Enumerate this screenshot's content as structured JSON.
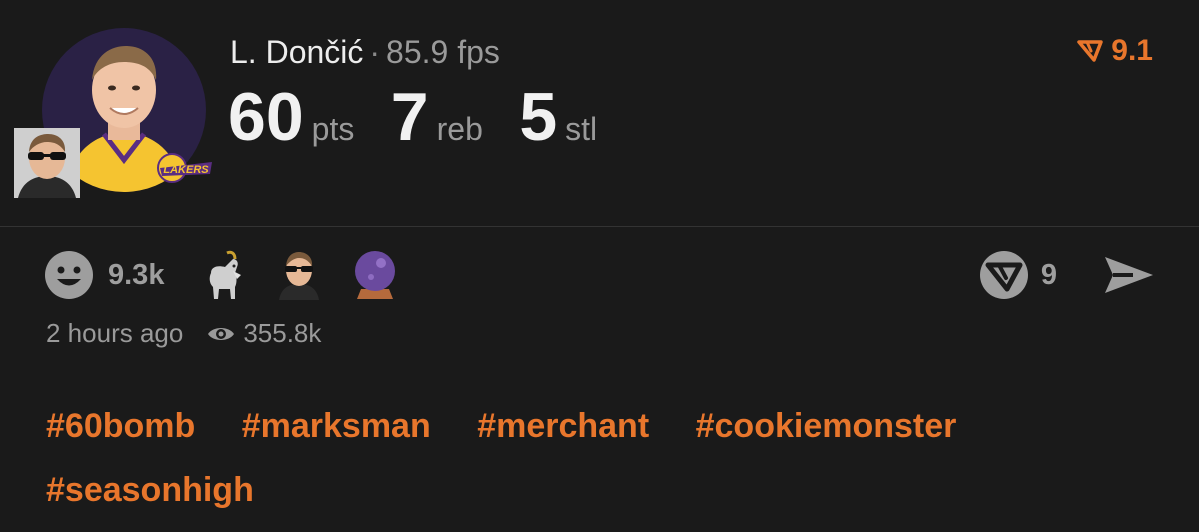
{
  "post": {
    "player_name": "L. Dončić",
    "separator": "·",
    "fps": "85.9 fps",
    "rating": "9.1",
    "stats": [
      {
        "value": "60",
        "unit": "pts"
      },
      {
        "value": "7",
        "unit": "reb"
      },
      {
        "value": "5",
        "unit": "stl"
      }
    ],
    "team_logo_text": "LAKERS"
  },
  "reactions": {
    "primary_icon": "smiley-face-icon",
    "count": "9.3k",
    "emojis": [
      "goat-icon",
      "sunglasses-avatar-icon",
      "crystal-ball-icon"
    ]
  },
  "comments": {
    "icon": "comment-logo-icon",
    "count": "9"
  },
  "share": {
    "icon": "send-icon"
  },
  "meta": {
    "time_ago": "2 hours ago",
    "views": "355.8k",
    "views_icon": "eye-icon"
  },
  "tags": [
    "#60bomb",
    "#marksman",
    "#merchant",
    "#cookiemonster",
    "#seasonhigh"
  ],
  "colors": {
    "accent": "#e8762c",
    "background": "#1a1a1a",
    "muted": "#9a9a9a",
    "avatar_bg": "#2a2145",
    "lakers_gold": "#f5c430"
  }
}
